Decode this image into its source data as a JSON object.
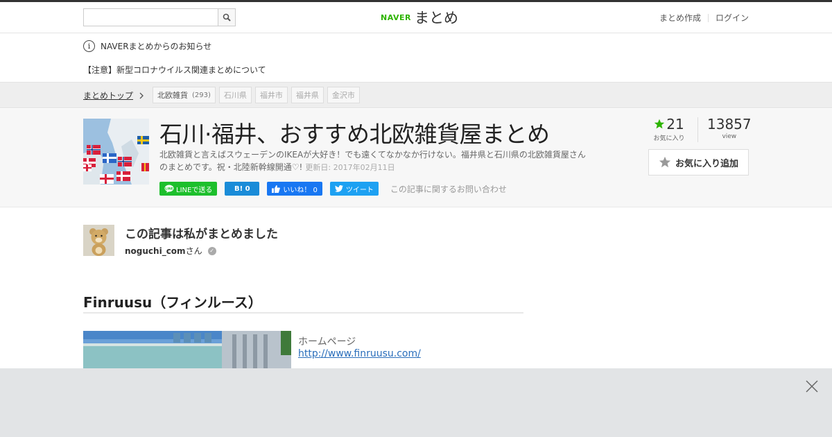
{
  "header": {
    "search": {
      "placeholder": "",
      "value": ""
    },
    "logo": {
      "brand": "NAVER",
      "service": "まとめ"
    },
    "links": [
      {
        "label": "まとめ作成"
      },
      {
        "label": "ログイン"
      }
    ]
  },
  "notice": {
    "heading": "NAVERまとめからのお知らせ",
    "link": "【注意】新型コロナウイルス関連まとめについて"
  },
  "breadcrumb": {
    "top": "まとめトップ",
    "tags": [
      {
        "label": "北欧雑貨",
        "count": "(293)"
      },
      {
        "label": "石川県"
      },
      {
        "label": "福井市"
      },
      {
        "label": "福井県"
      },
      {
        "label": "金沢市"
      }
    ]
  },
  "article": {
    "title": "石川·福井、おすすめ北欧雑貨屋まとめ",
    "description": "北欧雑貨と言えばスウェーデンのIKEAが大好き！でも遠くてなかなか行けない。福井県と石川県の北欧雑貨屋さんのまとめです。祝・北陸新幹線開通♡!",
    "updated": "更新日: 2017年02月11日",
    "share": {
      "line": "LINEで送る",
      "hatena": "B! 0",
      "facebook": "いいね！ 0",
      "twitter": "ツイート",
      "inquiry": "この記事に関するお問い合わせ"
    },
    "favorites": {
      "count": "21",
      "label": "お気に入り"
    },
    "views": {
      "count": "13857",
      "label": "view"
    },
    "fav_button": "お気に入り追加"
  },
  "author": {
    "heading": "この記事は私がまとめました",
    "name": "noguchi_com",
    "suffix": "さん"
  },
  "section": {
    "title": "Finruusu（フィンルース）",
    "homepage_label": "ホームページ",
    "homepage_url": "http://www.finruusu.com/"
  },
  "colors": {
    "naver_green": "#2db400",
    "line_green": "#1dbf2c",
    "hatena_blue": "#1a8cd8",
    "facebook_blue": "#1877f2",
    "twitter_blue": "#1da1f2",
    "star_green": "#2db400",
    "link_blue": "#2a6ebb"
  },
  "icons": {
    "search": "search-icon",
    "info": "info-icon",
    "chevron": "chevron-right-icon",
    "star": "star-icon",
    "close": "close-icon"
  }
}
